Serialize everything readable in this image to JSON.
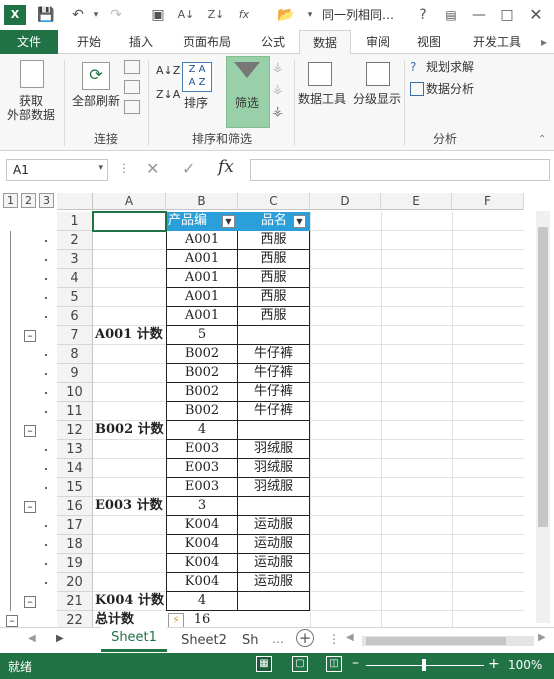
{
  "app": {
    "accent": "#217346",
    "window_title": "同一列相同…"
  },
  "tabs": [
    {
      "label": "文件",
      "key": "file"
    },
    {
      "label": "开始",
      "key": "home"
    },
    {
      "label": "插入",
      "key": "insert"
    },
    {
      "label": "页面布局",
      "key": "layout"
    },
    {
      "label": "公式",
      "key": "formulas"
    },
    {
      "label": "数据",
      "key": "data"
    },
    {
      "label": "审阅",
      "key": "review"
    },
    {
      "label": "视图",
      "key": "view"
    },
    {
      "label": "开发工具",
      "key": "dev"
    }
  ],
  "ribbon": {
    "get_external_1": "获取",
    "get_external_2": "外部数据",
    "refresh_all": "全部刷新",
    "connections": "连接",
    "sort": "排序",
    "filter": "筛选",
    "sort_filter": "排序和筛选",
    "data_tools": "数据工具",
    "outline": "分级显示",
    "solver": "规划求解",
    "data_analysis": "数据分析",
    "analysis": "分析"
  },
  "formula_bar": {
    "name_box": "A1",
    "formula": ""
  },
  "outline_levels": [
    "1",
    "2",
    "3"
  ],
  "columns": [
    "A",
    "B",
    "C",
    "D",
    "E",
    "F"
  ],
  "rows": [
    {
      "n": "1",
      "a": "",
      "b": "产品编",
      "c": "品名",
      "header": true
    },
    {
      "n": "2",
      "a": "",
      "b": "A001",
      "c": "西服"
    },
    {
      "n": "3",
      "a": "",
      "b": "A001",
      "c": "西服"
    },
    {
      "n": "4",
      "a": "",
      "b": "A001",
      "c": "西服"
    },
    {
      "n": "5",
      "a": "",
      "b": "A001",
      "c": "西服"
    },
    {
      "n": "6",
      "a": "",
      "b": "A001",
      "c": "西服"
    },
    {
      "n": "7",
      "a": "A001 计数",
      "b": "5",
      "c": "",
      "subtotal": true
    },
    {
      "n": "8",
      "a": "",
      "b": "B002",
      "c": "牛仔裤"
    },
    {
      "n": "9",
      "a": "",
      "b": "B002",
      "c": "牛仔裤"
    },
    {
      "n": "10",
      "a": "",
      "b": "B002",
      "c": "牛仔裤"
    },
    {
      "n": "11",
      "a": "",
      "b": "B002",
      "c": "牛仔裤"
    },
    {
      "n": "12",
      "a": "B002 计数",
      "b": "4",
      "c": "",
      "subtotal": true
    },
    {
      "n": "13",
      "a": "",
      "b": "E003",
      "c": "羽绒服"
    },
    {
      "n": "14",
      "a": "",
      "b": "E003",
      "c": "羽绒服"
    },
    {
      "n": "15",
      "a": "",
      "b": "E003",
      "c": "羽绒服"
    },
    {
      "n": "16",
      "a": "E003 计数",
      "b": "3",
      "c": "",
      "subtotal": true
    },
    {
      "n": "17",
      "a": "",
      "b": "K004",
      "c": "运动服"
    },
    {
      "n": "18",
      "a": "",
      "b": "K004",
      "c": "运动服"
    },
    {
      "n": "19",
      "a": "",
      "b": "K004",
      "c": "运动服"
    },
    {
      "n": "20",
      "a": "",
      "b": "K004",
      "c": "运动服"
    },
    {
      "n": "21",
      "a": "K004 计数",
      "b": "4",
      "c": "",
      "subtotal": true
    },
    {
      "n": "22",
      "a": "总计数",
      "b": "16",
      "c": "",
      "subtotal": true
    }
  ],
  "sheets": [
    "Sheet1",
    "Sheet2",
    "Sh"
  ],
  "status": {
    "ready": "就绪",
    "zoom": "100%"
  }
}
